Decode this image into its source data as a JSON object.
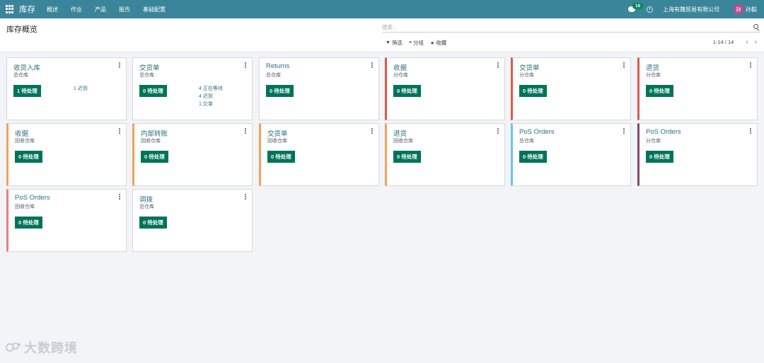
{
  "navbar": {
    "brand": "库存",
    "menu": [
      "概述",
      "作业",
      "产品",
      "报告",
      "基础配置"
    ],
    "chat_count": "16",
    "company": "上海有魏贸易有限公司",
    "avatar_char": "孙",
    "username": "孙毅",
    "bg_color": "#3a8599"
  },
  "control": {
    "title": "库存概览",
    "search_placeholder": "搜索...",
    "filter_label": "筛选",
    "group_label": "分组",
    "favorite_label": "收藏",
    "pager": "1-14 / 14"
  },
  "cards": [
    {
      "title": "收货入库",
      "subtitle": "总仓库",
      "button": "1 待处理",
      "stats": [
        "1 迟到"
      ],
      "accent": null
    },
    {
      "title": "交货单",
      "subtitle": "总仓库",
      "button": "0 待处理",
      "stats": [
        "4 正在等待",
        "4 迟到",
        "1 欠单"
      ],
      "accent": null
    },
    {
      "title": "Returns",
      "subtitle": "总仓库",
      "button": "0 待处理",
      "stats": [],
      "accent": null
    },
    {
      "title": "收据",
      "subtitle": "分仓库",
      "button": "0 待处理",
      "stats": [],
      "accent": "#e2574c"
    },
    {
      "title": "交货单",
      "subtitle": "分仓库",
      "button": "0 待处理",
      "stats": [],
      "accent": "#e2574c"
    },
    {
      "title": "退货",
      "subtitle": "分仓库",
      "button": "0 待处理",
      "stats": [],
      "accent": "#e2574c"
    },
    {
      "title": "收据",
      "subtitle": "回收仓库",
      "button": "0 待处理",
      "stats": [],
      "accent": "#f0a35c"
    },
    {
      "title": "内部转账",
      "subtitle": "回收仓库",
      "button": "0 待处理",
      "stats": [],
      "accent": "#f0a35c"
    },
    {
      "title": "交货单",
      "subtitle": "回收仓库",
      "button": "0 待处理",
      "stats": [],
      "accent": "#f0a35c"
    },
    {
      "title": "退货",
      "subtitle": "回收仓库",
      "button": "0 待处理",
      "stats": [],
      "accent": "#f0a35c"
    },
    {
      "title": "PoS Orders",
      "subtitle": "总仓库",
      "button": "0 待处理",
      "stats": [],
      "accent": "#6cc1ed"
    },
    {
      "title": "PoS Orders",
      "subtitle": "分仓库",
      "button": "0 待处理",
      "stats": [],
      "accent": "#814968"
    },
    {
      "title": "PoS Orders",
      "subtitle": "回收仓库",
      "button": "0 待处理",
      "stats": [],
      "accent": "#eb7e7f"
    },
    {
      "title": "调拨",
      "subtitle": "总仓库",
      "button": "0 待处理",
      "stats": [],
      "accent": null
    }
  ],
  "watermark": "大数跨境"
}
